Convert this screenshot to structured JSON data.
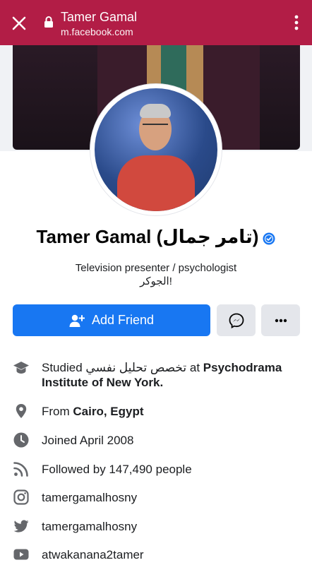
{
  "browser": {
    "title": "Tamer Gamal",
    "url": "m.facebook.com",
    "close_icon": "close-icon",
    "lock_icon": "lock-icon",
    "menu_icon": "more-vertical-icon",
    "accent_color": "#b21d46"
  },
  "profile": {
    "name": "Tamer Gamal (تامر جمال)",
    "bio_line1": "Television presenter / psychologist",
    "bio_line2": "الجوكر!"
  },
  "actions": {
    "add_friend_label": "Add Friend",
    "add_friend_color": "#1877f2"
  },
  "intro": {
    "education_prefix": "Studied",
    "education_field": "تخصص تحليل نفسي",
    "education_at": "at",
    "education_school": "Psychodrama Institute of New York.",
    "location_prefix": "From",
    "location": "Cairo, Egypt",
    "joined": "Joined April 2008",
    "followers": "Followed by 147,490 people",
    "instagram": "tamergamalhosny",
    "twitter": "tamergamalhosny",
    "youtube": "atwakanana2tamer"
  }
}
